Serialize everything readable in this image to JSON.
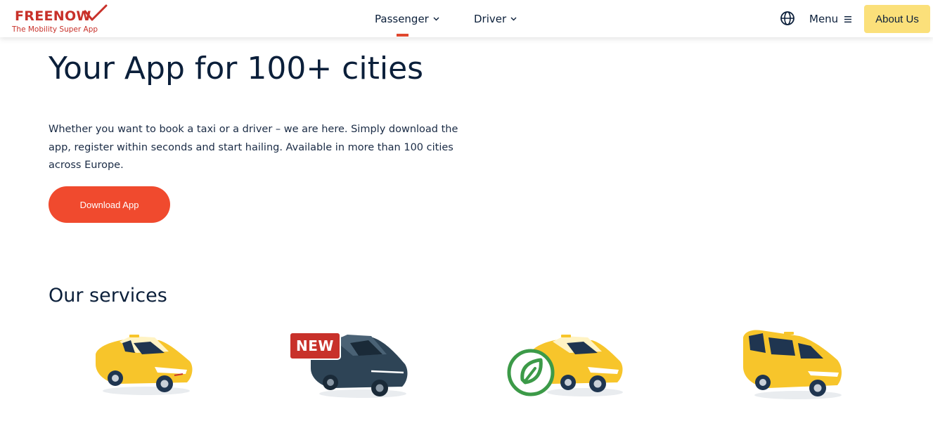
{
  "header": {
    "logo_word": "FREENOW",
    "logo_tagline": "The Mobility Super App",
    "nav": [
      {
        "label": "Passenger"
      },
      {
        "label": "Driver"
      }
    ],
    "menu_label": "Menu",
    "about_label": "About Us"
  },
  "hero": {
    "title": "Your App for 100+ cities",
    "description": "Whether you want to book a taxi or a driver – we are here. Simply download the app, register within seconds and start hailing. Available in more than 100 cities across Europe.",
    "cta_label": "Download App"
  },
  "services": {
    "title": "Our services",
    "badge_new": "NEW"
  },
  "colors": {
    "brand_red": "#c8312a",
    "cta_orange": "#f04a2e",
    "about_yellow": "#fbe07a",
    "text_navy": "#0b1f3a",
    "taxi_yellow": "#f7c52b",
    "dark_car": "#2e4456",
    "eco_green": "#3c9a48"
  },
  "icons": [
    "logo-check-icon",
    "chevron-down-icon",
    "globe-icon",
    "hamburger-icon",
    "leaf-icon"
  ]
}
